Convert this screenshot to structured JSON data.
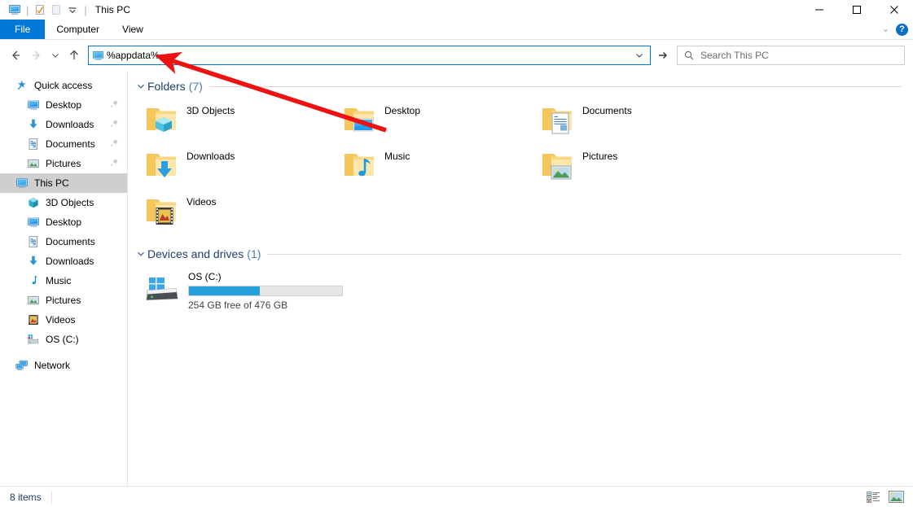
{
  "window": {
    "title": "This PC",
    "quick_access_icons": [
      "this-pc-icon",
      "properties-icon",
      "new-folder-icon",
      "customize-dropdown-icon"
    ],
    "buttons": {
      "minimize": "minimize-button",
      "maximize": "maximize-button",
      "close": "close-button"
    }
  },
  "ribbon": {
    "tabs": [
      {
        "label": "File",
        "active": true
      },
      {
        "label": "Computer",
        "active": false
      },
      {
        "label": "View",
        "active": false
      }
    ],
    "collapse_label": "⌄",
    "help_label": "?"
  },
  "address_bar": {
    "back_tooltip": "Back",
    "forward_tooltip": "Forward",
    "recent_tooltip": "Recent locations",
    "up_tooltip": "Up",
    "path_value": "%appdata%",
    "path_icon": "this-pc-icon",
    "go_label": "→",
    "dropdown_label": "⌄"
  },
  "search": {
    "placeholder": "Search This PC",
    "value": ""
  },
  "sidebar": {
    "items": [
      {
        "label": "Quick access",
        "icon": "star-pin-icon",
        "level": 0,
        "pinned": false,
        "selected": false
      },
      {
        "label": "Desktop",
        "icon": "desktop-icon",
        "level": 1,
        "pinned": true,
        "selected": false
      },
      {
        "label": "Downloads",
        "icon": "downloads-icon",
        "level": 1,
        "pinned": true,
        "selected": false
      },
      {
        "label": "Documents",
        "icon": "documents-icon",
        "level": 1,
        "pinned": true,
        "selected": false
      },
      {
        "label": "Pictures",
        "icon": "pictures-icon",
        "level": 1,
        "pinned": true,
        "selected": false
      },
      {
        "label": "This PC",
        "icon": "this-pc-icon",
        "level": 0,
        "pinned": false,
        "selected": true
      },
      {
        "label": "3D Objects",
        "icon": "3d-objects-icon",
        "level": 1,
        "pinned": false,
        "selected": false
      },
      {
        "label": "Desktop",
        "icon": "desktop-icon",
        "level": 1,
        "pinned": false,
        "selected": false
      },
      {
        "label": "Documents",
        "icon": "documents-icon",
        "level": 1,
        "pinned": false,
        "selected": false
      },
      {
        "label": "Downloads",
        "icon": "downloads-icon",
        "level": 1,
        "pinned": false,
        "selected": false
      },
      {
        "label": "Music",
        "icon": "music-icon",
        "level": 1,
        "pinned": false,
        "selected": false
      },
      {
        "label": "Pictures",
        "icon": "pictures-icon",
        "level": 1,
        "pinned": false,
        "selected": false
      },
      {
        "label": "Videos",
        "icon": "videos-icon",
        "level": 1,
        "pinned": false,
        "selected": false
      },
      {
        "label": "OS (C:)",
        "icon": "drive-icon",
        "level": 1,
        "pinned": false,
        "selected": false
      },
      {
        "label": "Network",
        "icon": "network-icon",
        "level": 0,
        "pinned": false,
        "selected": false
      }
    ]
  },
  "content": {
    "groups": [
      {
        "title": "Folders",
        "count": "(7)",
        "chevron": "⌄",
        "items": [
          {
            "label": "3D Objects",
            "icon": "folder-3d-objects-icon"
          },
          {
            "label": "Desktop",
            "icon": "folder-desktop-icon"
          },
          {
            "label": "Documents",
            "icon": "folder-documents-icon"
          },
          {
            "label": "Downloads",
            "icon": "folder-downloads-icon"
          },
          {
            "label": "Music",
            "icon": "folder-music-icon"
          },
          {
            "label": "Pictures",
            "icon": "folder-pictures-icon"
          },
          {
            "label": "Videos",
            "icon": "folder-videos-icon"
          }
        ]
      },
      {
        "title": "Devices and drives",
        "count": "(1)",
        "chevron": "⌄",
        "drives": [
          {
            "name": "OS (C:)",
            "free_text": "254 GB free of 476 GB",
            "used_percent": 46.5,
            "bar_color": "#26a0da",
            "icon": "windows-drive-icon"
          }
        ]
      }
    ]
  },
  "status_bar": {
    "item_count": "8 items",
    "views": [
      {
        "name": "details-view-button",
        "label": "Details view"
      },
      {
        "name": "large-icons-view-button",
        "label": "Large icons view"
      }
    ]
  },
  "annotation": {
    "arrow_color": "#ee1111",
    "description": "red arrow pointing to address bar"
  },
  "colors": {
    "accent": "#0078d7",
    "group_title": "#1f3f6e",
    "group_count": "#4a77b5",
    "selection": "#cfcfcf",
    "drive_fill": "#26a0da"
  }
}
